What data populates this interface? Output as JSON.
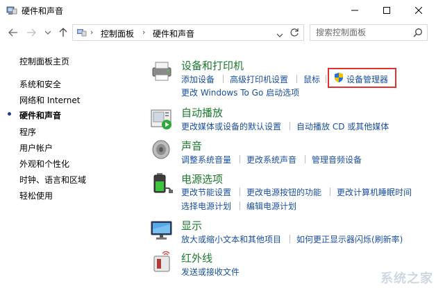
{
  "window": {
    "title": "硬件和声音"
  },
  "address": {
    "crumbs": [
      "控制面板",
      "硬件和声音"
    ]
  },
  "search": {
    "placeholder": "搜索控制面板"
  },
  "sidebar": {
    "items": [
      {
        "label": "控制面板主页"
      },
      {
        "label": "系统和安全"
      },
      {
        "label": "网络和 Internet"
      },
      {
        "label": "硬件和声音",
        "active": true
      },
      {
        "label": "程序"
      },
      {
        "label": "用户帐户"
      },
      {
        "label": "外观和个性化"
      },
      {
        "label": "时钟、语言和区域"
      },
      {
        "label": "轻松使用"
      }
    ]
  },
  "categories": {
    "devices": {
      "title": "设备和打印机",
      "links": [
        "添加设备",
        "高级打印机设置",
        "鼠标",
        "设备管理器",
        "更改 Windows To Go 启动选项"
      ],
      "icon": "printer-icon"
    },
    "autoplay": {
      "title": "自动播放",
      "links": [
        "更改媒体或设备的默认设置",
        "自动播放 CD 或其他媒体"
      ],
      "icon": "autoplay-icon"
    },
    "sound": {
      "title": "声音",
      "links": [
        "调整系统音量",
        "更改系统声音",
        "管理音频设备"
      ],
      "icon": "speaker-icon"
    },
    "power": {
      "title": "电源选项",
      "links": [
        "更改节能设置",
        "更改电源按钮的功能",
        "更改计算机睡眠时间",
        "选择电源计划",
        "编辑电源计划"
      ],
      "icon": "battery-icon"
    },
    "display": {
      "title": "显示",
      "links": [
        "放大或缩小文本和其他项目",
        "如何更正显示器闪烁(刷新率)"
      ],
      "icon": "monitor-icon"
    },
    "infrared": {
      "title": "红外线",
      "links": [
        "发送或接收文件"
      ],
      "icon": "infrared-icon"
    }
  },
  "colors": {
    "category_title": "#1a7a2e",
    "link": "#1a4fa0",
    "highlight": "#e03030"
  },
  "watermark": "系统之家"
}
